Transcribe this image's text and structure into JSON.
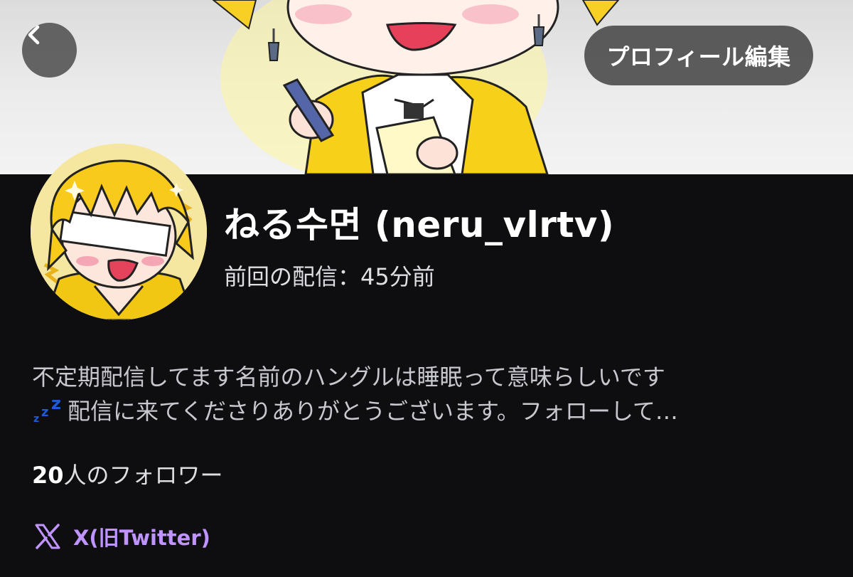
{
  "header": {
    "back_icon": "chevron-left-icon",
    "edit_profile_label": "プロフィール編集"
  },
  "profile": {
    "display_name": "ねる수면 (neru_vlrtv)",
    "last_stream": "前回の配信：45分前",
    "bio_line1": "不定期配信してます名前のハングルは睡眠って意味らしいです",
    "bio_emoji": "zzz-emoji",
    "bio_line2": "配信に来てくださりありがとうございます。フォローして…",
    "followers_count": "20",
    "followers_label": "人のフォロワー"
  },
  "links": {
    "social_icon": "x-logo-icon",
    "social_label": "X(旧Twitter)"
  },
  "colors": {
    "background": "#0e0e10",
    "link": "#bf94ff",
    "avatar_hair": "#f7c91a",
    "emoji_zzz": "#1f5bd6"
  }
}
